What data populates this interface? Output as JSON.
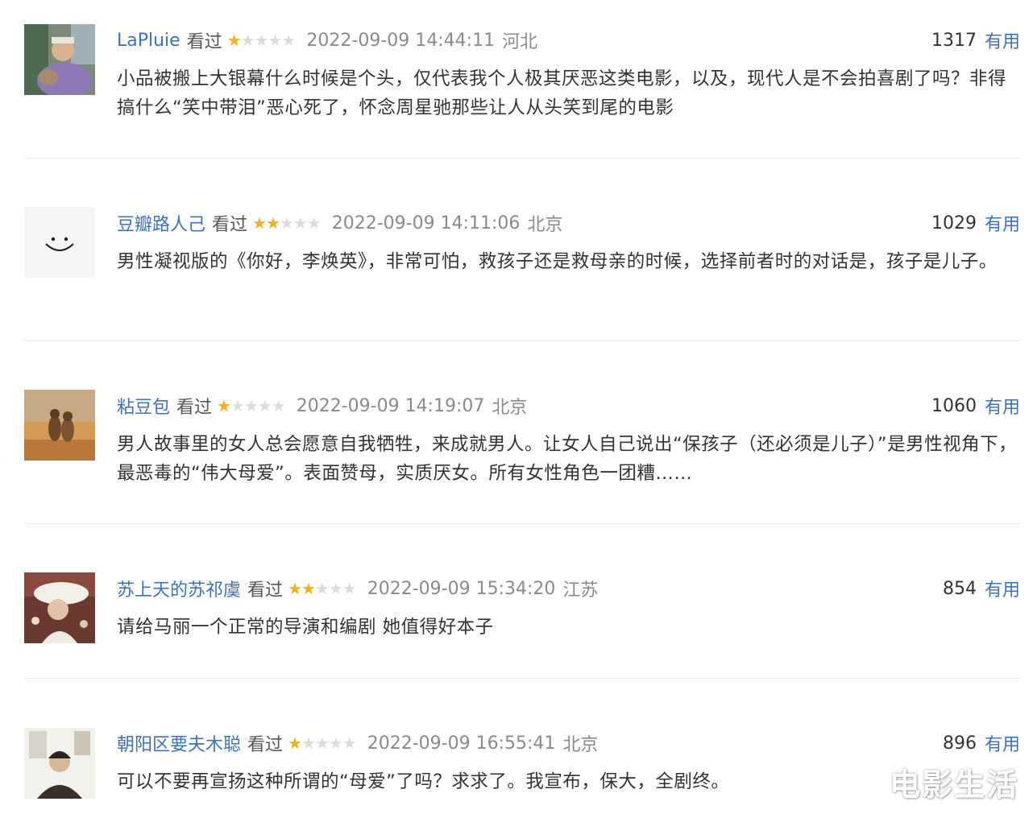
{
  "reviews": [
    {
      "user": "LaPluie",
      "watched": "看过",
      "rating": 1,
      "time": "2022-09-09 14:44:11",
      "location": "河北",
      "votes": "1317",
      "useful_label": "有用",
      "text": "小品被搬上大银幕什么时候是个头，仅代表我个人极其厌恶这类电影，以及，现代人是不会拍喜剧了吗？非得搞什么“笑中带泪”恶心死了，怀念周星驰那些让人从头笑到尾的电影"
    },
    {
      "user": "豆瓣路人己",
      "watched": "看过",
      "rating": 2,
      "time": "2022-09-09 14:11:06",
      "location": "北京",
      "votes": "1029",
      "useful_label": "有用",
      "text": "男性凝视版的《你好，李焕英》，非常可怕，救孩子还是救母亲的时候，选择前者时的对话是，孩子是儿子。"
    },
    {
      "user": "粘豆包",
      "watched": "看过",
      "rating": 1,
      "time": "2022-09-09 14:19:07",
      "location": "北京",
      "votes": "1060",
      "useful_label": "有用",
      "text": "男人故事里的女人总会愿意自我牺牲，来成就男人。让女人自己说出“保孩子（还必须是儿子）”是男性视角下，最恶毒的“伟大母爱”。表面赞母，实质厌女。所有女性角色一团糟……"
    },
    {
      "user": "苏上天的苏祁虞",
      "watched": "看过",
      "rating": 2,
      "time": "2022-09-09 15:34:20",
      "location": "江苏",
      "votes": "854",
      "useful_label": "有用",
      "text": "请给马丽一个正常的导演和编剧 她值得好本子"
    },
    {
      "user": "朝阳区要夫木聪",
      "watched": "看过",
      "rating": 1,
      "time": "2022-09-09 16:55:41",
      "location": "北京",
      "votes": "896",
      "useful_label": "有用",
      "text": "可以不要再宣扬这种所谓的“母爱”了吗？求求了。我宣布，保大，全剧终。"
    }
  ],
  "watermark": "电影生活"
}
